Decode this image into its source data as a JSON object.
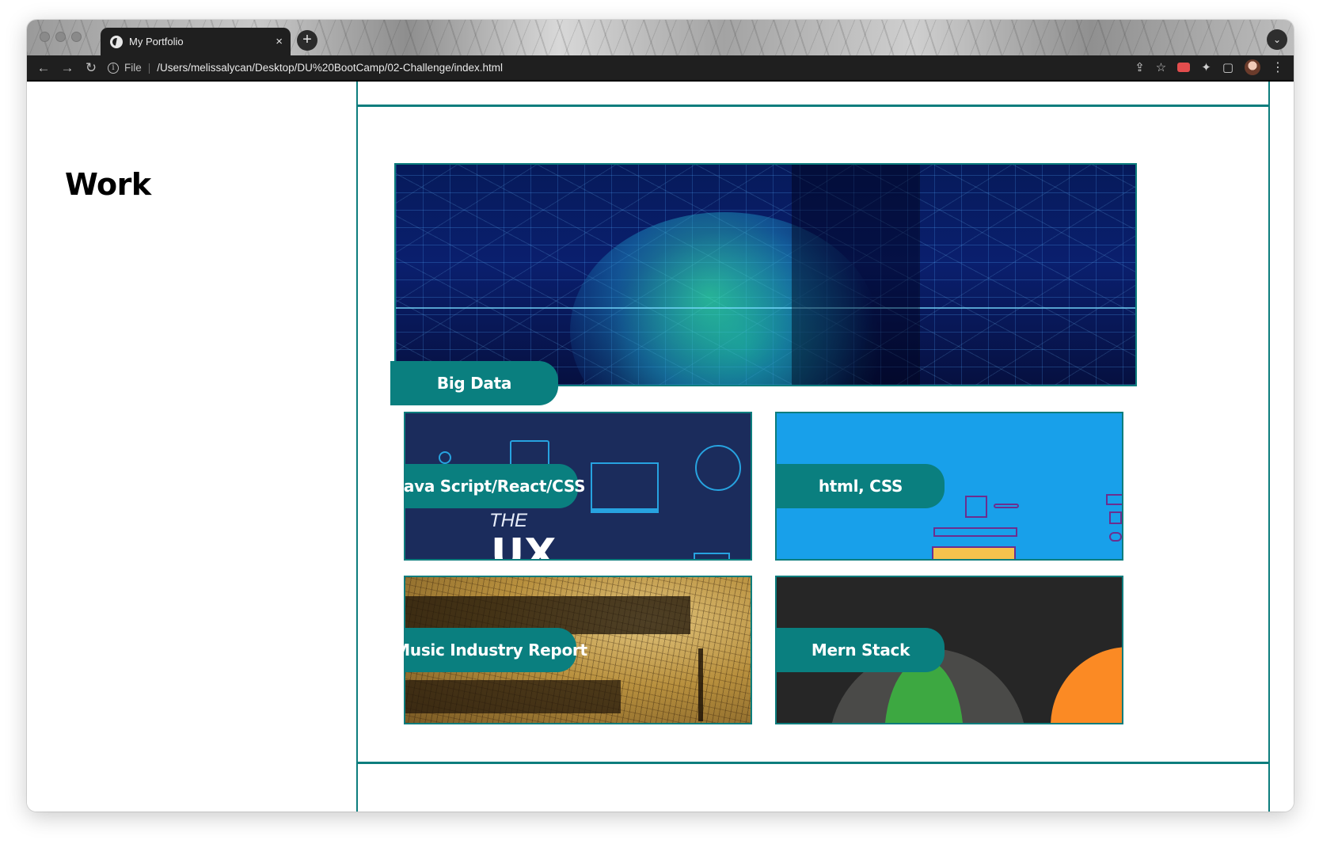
{
  "browser": {
    "tab_title": "My Portfolio",
    "tab_close": "×",
    "new_tab": "+",
    "tab_search": "⌄",
    "back": "←",
    "forward": "→",
    "reload": "↻",
    "info": "i",
    "scheme": "File",
    "url": "/Users/melissalycan/Desktop/DU%20BootCamp/02-Challenge/index.html",
    "share": "⇪",
    "bookmark": "☆",
    "puzzle": "✦",
    "sidepanel": "▢",
    "menu": "⋮"
  },
  "page": {
    "section_heading": "Work",
    "projects": [
      {
        "label": "Big Data"
      },
      {
        "label": "Java Script/React/CSS"
      },
      {
        "label": "html, CSS"
      },
      {
        "label": "Music Industry Report"
      },
      {
        "label": "Mern Stack"
      }
    ],
    "ux_art": {
      "the": "THE",
      "big": "UX"
    }
  },
  "colors": {
    "accent_teal": "#0d7d7d",
    "label_teal": "#0a7f7f",
    "toolbar": "#1f1f1f"
  }
}
